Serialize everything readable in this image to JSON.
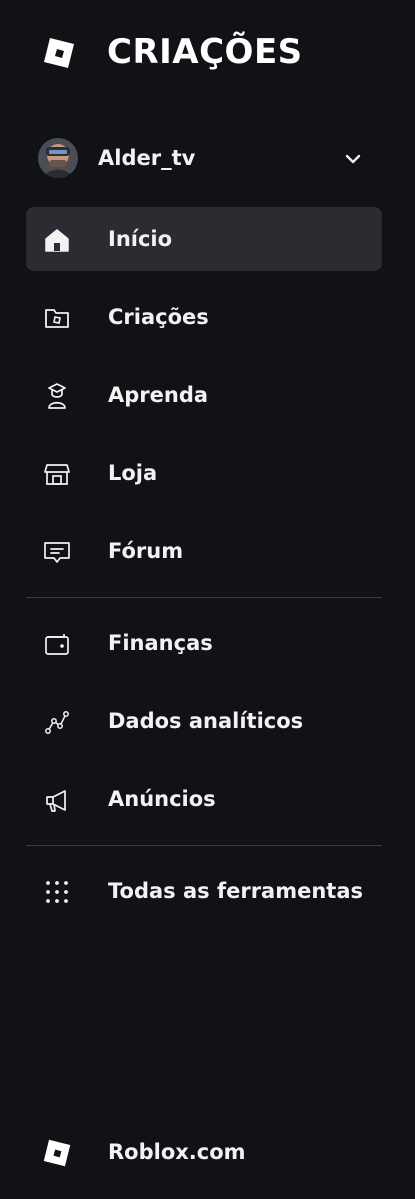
{
  "header": {
    "title": "CRIAÇÕES",
    "logo_icon": "roblox-logo-icon"
  },
  "user": {
    "name": "Alder_tv",
    "avatar_icon": "avatar",
    "menu_icon": "chevron-down-icon"
  },
  "nav": {
    "primary": [
      {
        "label": "Início",
        "icon": "home-icon",
        "active": true
      },
      {
        "label": "Criações",
        "icon": "folder-icon",
        "active": false
      },
      {
        "label": "Aprenda",
        "icon": "graduation-icon",
        "active": false
      },
      {
        "label": "Loja",
        "icon": "store-icon",
        "active": false
      },
      {
        "label": "Fórum",
        "icon": "forum-icon",
        "active": false
      }
    ],
    "secondary": [
      {
        "label": "Finanças",
        "icon": "wallet-icon"
      },
      {
        "label": "Dados analíticos",
        "icon": "analytics-icon"
      },
      {
        "label": "Anúncios",
        "icon": "megaphone-icon"
      }
    ],
    "all_tools": {
      "label": "Todas as ferramentas",
      "icon": "grid-icon"
    }
  },
  "footer": {
    "link_label": "Roblox.com",
    "icon": "roblox-logo-icon"
  },
  "colors": {
    "background": "#111216",
    "active_background": "#2b2c31",
    "text": "#f2f2f3",
    "divider": "#393b41"
  }
}
